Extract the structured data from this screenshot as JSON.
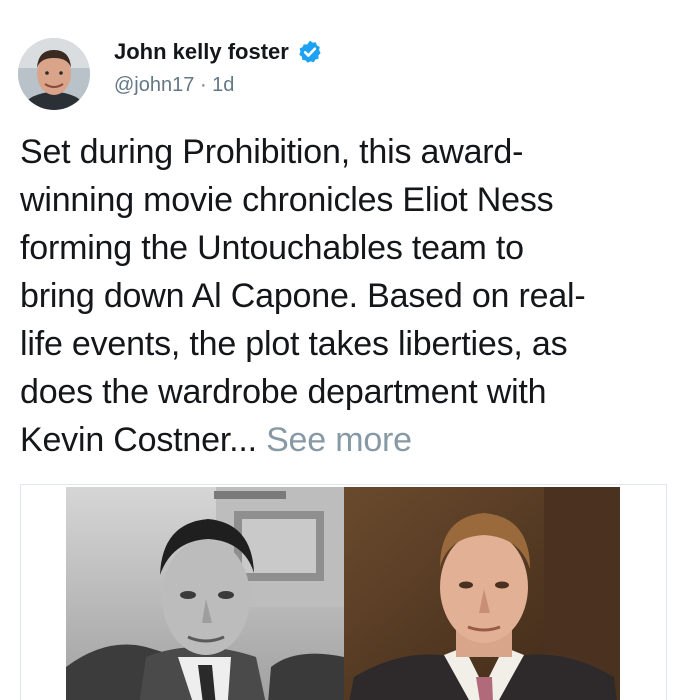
{
  "author": {
    "display_name": "John kelly foster",
    "handle": "@john17",
    "separator": "·",
    "time_ago": "1d",
    "verified_icon": "verified-badge-icon",
    "verified_color": "#1da1f2"
  },
  "tweet": {
    "text_lines": [
      "Set during Prohibition, this award-",
      "winning movie chronicles Eliot Ness",
      "forming the Untouchables team to",
      "bring down Al Capone. Based on real-",
      "life events, the plot takes liberties, as",
      "does the wardrobe department with",
      "Kevin Costner..."
    ],
    "see_more_label": "See more"
  },
  "media": {
    "left_photo": "black-and-white portrait of Eliot Ness",
    "right_photo": "color portrait of Kevin Costner in suit"
  },
  "colors": {
    "text_primary": "#14171a",
    "text_secondary": "#657786",
    "see_more": "#8899a6",
    "accent": "#1da1f2"
  }
}
